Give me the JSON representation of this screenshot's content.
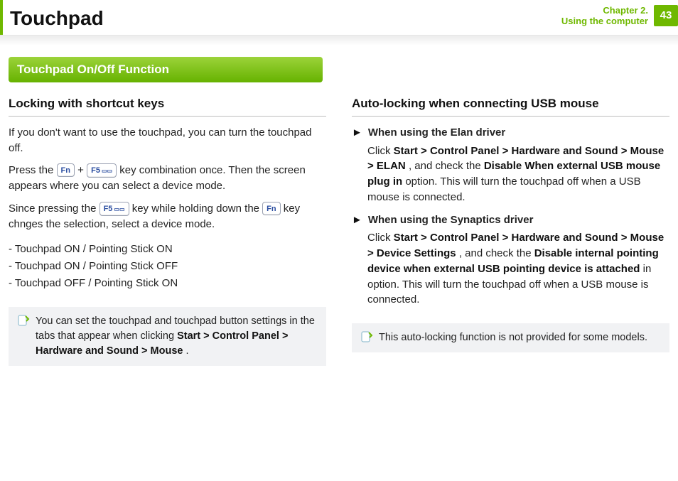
{
  "header": {
    "title": "Touchpad",
    "chapter_line1": "Chapter 2.",
    "chapter_line2": "Using the computer",
    "page_number": "43"
  },
  "section_bar": "Touchpad On/Off Function",
  "left": {
    "heading": "Locking with shortcut keys",
    "p1": "If you don't want to use the touchpad, you can turn the touchpad off.",
    "p2a": "Press the ",
    "p2b": " + ",
    "p2c": " key combination once. Then the screen appears where you can select a device mode.",
    "p3a": "Since pressing the ",
    "p3b": " key while holding down the ",
    "p3c": " key chnges the selection, select a device mode.",
    "modes": {
      "m1": "- Touchpad ON / Pointing Stick ON",
      "m2": "- Touchpad ON / Pointing Stick OFF",
      "m3": "- Touchpad OFF / Pointing Stick ON"
    },
    "note_a": "You can set the touchpad and touchpad button settings in the tabs that appear when clicking ",
    "note_b_bold": "Start > Control Panel > Hardware and Sound > Mouse",
    "note_c": "."
  },
  "right": {
    "heading": "Auto-locking when connecting USB mouse",
    "elan": {
      "title": "When using the Elan driver",
      "t_click": "Click ",
      "t_path": "Start > Control Panel > Hardware and Sound > Mouse > ELAN",
      "t_mid": ", and check the ",
      "t_opt": "Disable When external USB mouse plug in",
      "t_tail": " option. This will turn the touchpad off when a USB mouse is connected."
    },
    "syn": {
      "title": "When using the Synaptics driver",
      "t_click": "Click ",
      "t_path": "Start > Control Panel > Hardware and Sound > Mouse > Device Settings",
      "t_mid": ", and check the ",
      "t_opt": "Disable internal pointing device when external USB pointing device is attached",
      "t_tail": " in option. This will turn the touchpad off when a USB mouse is connected."
    },
    "note": "This auto-locking function is not provided for some models."
  },
  "keys": {
    "fn": "Fn",
    "f5": "F5"
  }
}
